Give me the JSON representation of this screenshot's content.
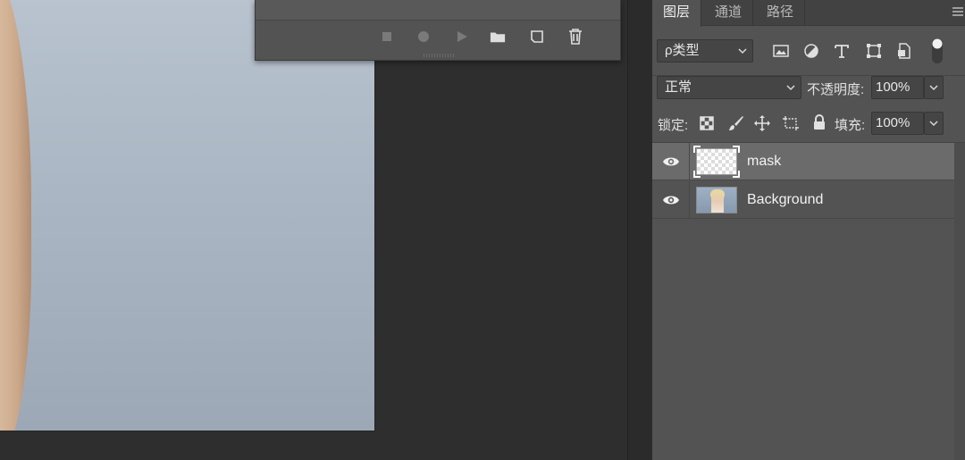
{
  "actions_panel": {
    "icons": [
      "stop-icon",
      "record-icon",
      "play-icon",
      "folder-icon",
      "new-action-icon",
      "trash-icon"
    ]
  },
  "layers_panel": {
    "tabs": [
      {
        "label": "图层",
        "active": true
      },
      {
        "label": "通道",
        "active": false
      },
      {
        "label": "路径",
        "active": false
      }
    ],
    "filter": {
      "kind_label": "ρ类型",
      "filter_icons": [
        "image-filter-icon",
        "adjustment-filter-icon",
        "type-filter-icon",
        "shape-filter-icon",
        "smart-object-filter-icon",
        "filter-toggle-icon"
      ]
    },
    "blend": {
      "mode": "正常",
      "opacity_label": "不透明度:",
      "opacity_value": "100%"
    },
    "lock": {
      "label": "锁定:",
      "icons": [
        "lock-transparent-icon",
        "lock-paint-icon",
        "lock-move-icon",
        "lock-artboard-icon",
        "lock-all-icon"
      ],
      "fill_label": "填充:",
      "fill_value": "100%"
    },
    "layers": [
      {
        "name": "mask",
        "visible": true,
        "selected": true,
        "thumb": "transparent"
      },
      {
        "name": "Background",
        "visible": true,
        "selected": false,
        "thumb": "photo"
      }
    ]
  },
  "colors": {
    "panel_bg": "#535353",
    "selected_row": "#6b6b6b",
    "canvas_bg": "#aab6c3"
  }
}
